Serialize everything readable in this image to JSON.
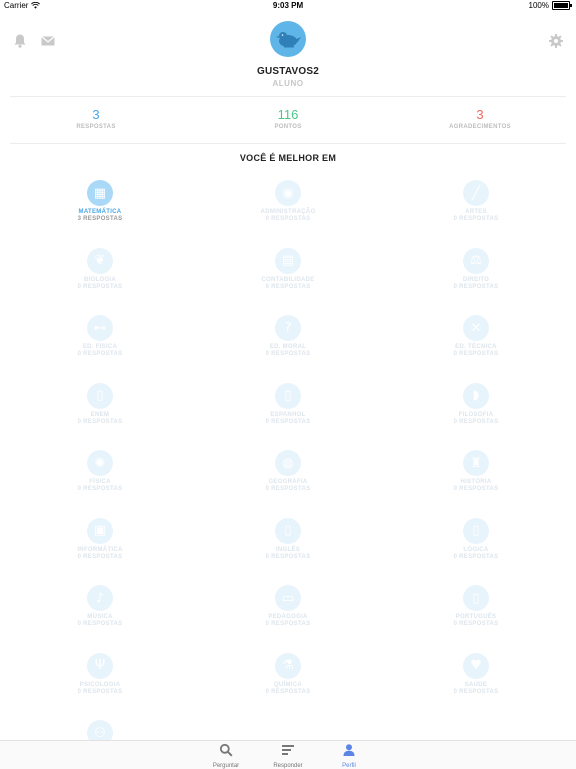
{
  "status_bar": {
    "carrier": "Carrier",
    "time": "9:03 PM",
    "battery": "100%"
  },
  "colors": {
    "accent_blue": "#4aa7e6",
    "green": "#4cc78b",
    "red": "#f06a5c",
    "tab_active": "#5b86e5"
  },
  "header": {
    "icons": [
      "bell-icon",
      "envelope-icon",
      "gear-icon"
    ],
    "username": "GUSTAVOS2",
    "role": "ALUNO"
  },
  "stats": [
    {
      "value": "3",
      "label": "RESPOSTAS",
      "color": "#4aa7e6"
    },
    {
      "value": "116",
      "label": "PONTOS",
      "color": "#4cc78b"
    },
    {
      "value": "3",
      "label": "AGRADECIMENTOS",
      "color": "#f06a5c"
    }
  ],
  "section_title": "VOCÊ É MELHOR EM",
  "subjects": [
    {
      "name": "MATEMÁTICA",
      "count": "3 RESPOSTAS",
      "icon": "calculator-icon"
    },
    {
      "name": "ADMINISTRAÇÃO",
      "count": "0 RESPOSTAS",
      "icon": "eye-icon"
    },
    {
      "name": "ARTES",
      "count": "0 RESPOSTAS",
      "icon": "brush-icon"
    },
    {
      "name": "BIOLOGIA",
      "count": "0 RESPOSTAS",
      "icon": "leaf-icon"
    },
    {
      "name": "CONTABILIDADE",
      "count": "0 RESPOSTAS",
      "icon": "ledger-icon"
    },
    {
      "name": "DIREITO",
      "count": "0 RESPOSTAS",
      "icon": "scales-icon"
    },
    {
      "name": "ED. FÍSICA",
      "count": "0 RESPOSTAS",
      "icon": "dumbbell-icon"
    },
    {
      "name": "ED. MORAL",
      "count": "0 RESPOSTAS",
      "icon": "question-icon"
    },
    {
      "name": "ED. TÉCNICA",
      "count": "0 RESPOSTAS",
      "icon": "tools-icon"
    },
    {
      "name": "ENEM",
      "count": "0 RESPOSTAS",
      "icon": "book-icon"
    },
    {
      "name": "ESPANHOL",
      "count": "0 RESPOSTAS",
      "icon": "book-icon"
    },
    {
      "name": "FILOSOFIA",
      "count": "0 RESPOSTAS",
      "icon": "speech-bubble-icon"
    },
    {
      "name": "FÍSICA",
      "count": "0 RESPOSTAS",
      "icon": "atom-icon"
    },
    {
      "name": "GEOGRAFIA",
      "count": "0 RESPOSTAS",
      "icon": "globe-icon"
    },
    {
      "name": "HISTÓRIA",
      "count": "0 RESPOSTAS",
      "icon": "column-icon"
    },
    {
      "name": "INFORMÁTICA",
      "count": "0 RESPOSTAS",
      "icon": "chip-icon"
    },
    {
      "name": "INGLÊS",
      "count": "0 RESPOSTAS",
      "icon": "book-icon"
    },
    {
      "name": "LÓGICA",
      "count": "0 RESPOSTAS",
      "icon": "book-icon"
    },
    {
      "name": "MÚSICA",
      "count": "0 RESPOSTAS",
      "icon": "music-note-icon"
    },
    {
      "name": "PEDAGOGIA",
      "count": "0 RESPOSTAS",
      "icon": "board-icon"
    },
    {
      "name": "PORTUGUÊS",
      "count": "0 RESPOSTAS",
      "icon": "book-icon"
    },
    {
      "name": "PSICOLOGIA",
      "count": "0 RESPOSTAS",
      "icon": "psi-icon"
    },
    {
      "name": "QUÍMICA",
      "count": "0 RESPOSTAS",
      "icon": "flask-icon"
    },
    {
      "name": "SAÚDE",
      "count": "0 RESPOSTAS",
      "icon": "heart-icon"
    },
    {
      "name": "",
      "count": "",
      "icon": "people-icon"
    }
  ],
  "tabs": [
    {
      "label": "Perguntar",
      "icon": "search-icon",
      "active": false
    },
    {
      "label": "Responder",
      "icon": "list-icon",
      "active": false
    },
    {
      "label": "Perfil",
      "icon": "person-icon",
      "active": true
    }
  ]
}
